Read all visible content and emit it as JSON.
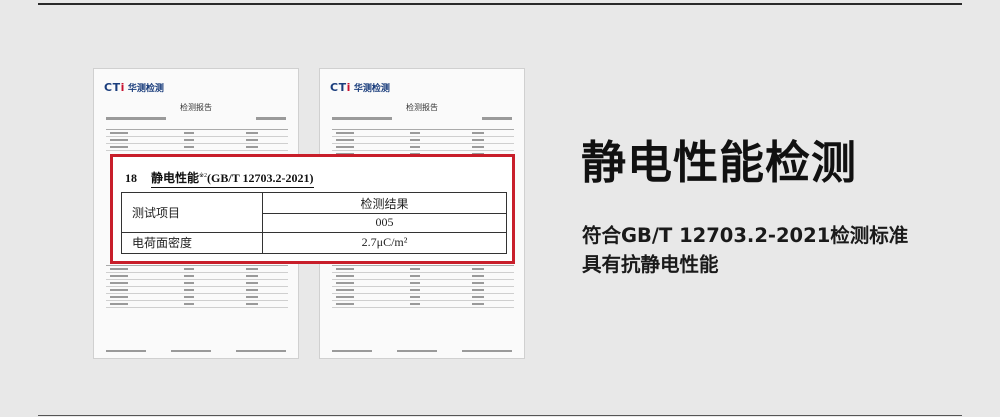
{
  "logo": {
    "cti_prefix": "CT",
    "cti_suffix": "i",
    "name": "华测检测"
  },
  "report": {
    "title": "检测报告"
  },
  "section": {
    "number": "18",
    "title": "静电性能",
    "superscript": "※2",
    "standard": "(GB/T 12703.2-2021)"
  },
  "table": {
    "header_label": "测试项目",
    "result_label": "检测结果",
    "sample_id": "005",
    "row_label": "电荷面密度",
    "row_value": "2.7μC/m²"
  },
  "headline": "静电性能检测",
  "description_line1": "符合GB/T 12703.2-2021检测标准",
  "description_line2": "具有抗静电性能",
  "colors": {
    "accent": "#c81e2a",
    "brand": "#1a3d7c"
  }
}
